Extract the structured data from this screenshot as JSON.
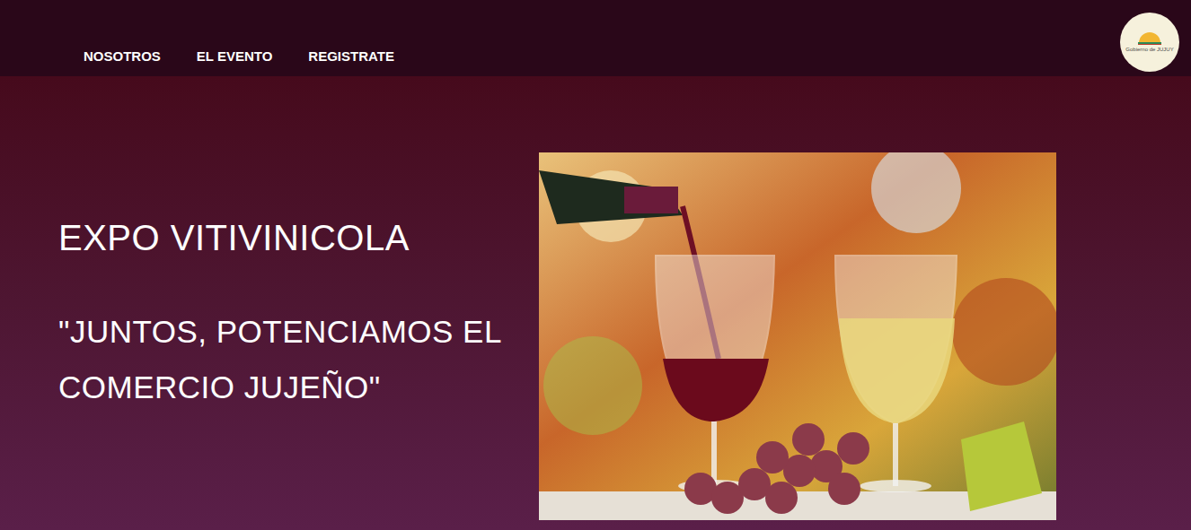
{
  "nav": {
    "items": [
      "NOSOTROS",
      "EL EVENTO",
      "REGISTRATE"
    ]
  },
  "logo": {
    "text": "Gobierno de JUJUY"
  },
  "hero": {
    "title": "EXPO VITIVINICOLA",
    "subtitle": "\"JUNTOS, POTENCIAMOS EL COMERCIO JUJEÑO\""
  }
}
